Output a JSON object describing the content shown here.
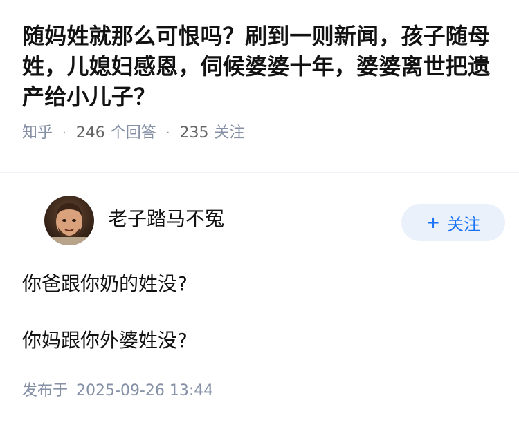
{
  "question": {
    "title": "随妈姓就那么可恨吗？刷到一则新闻，孩子随母姓，儿媳妇感恩，伺候婆婆十年，婆婆离世把遗产给小儿子？",
    "site": "知乎",
    "answer_count": "246",
    "answer_label": "个回答",
    "follow_count": "235",
    "follow_label": "关注"
  },
  "answer": {
    "author_name": "老子踏马不冤",
    "follow_button": "关注",
    "paragraphs": [
      "你爸跟你奶的姓没?",
      "你妈跟你外婆姓没?"
    ],
    "published_label": "发布于",
    "published_time": "2025-09-26 13:44"
  },
  "colors": {
    "meta_gray": "#8590a6",
    "follow_blue": "#1772f6",
    "follow_bg": "#eaf1fb"
  }
}
